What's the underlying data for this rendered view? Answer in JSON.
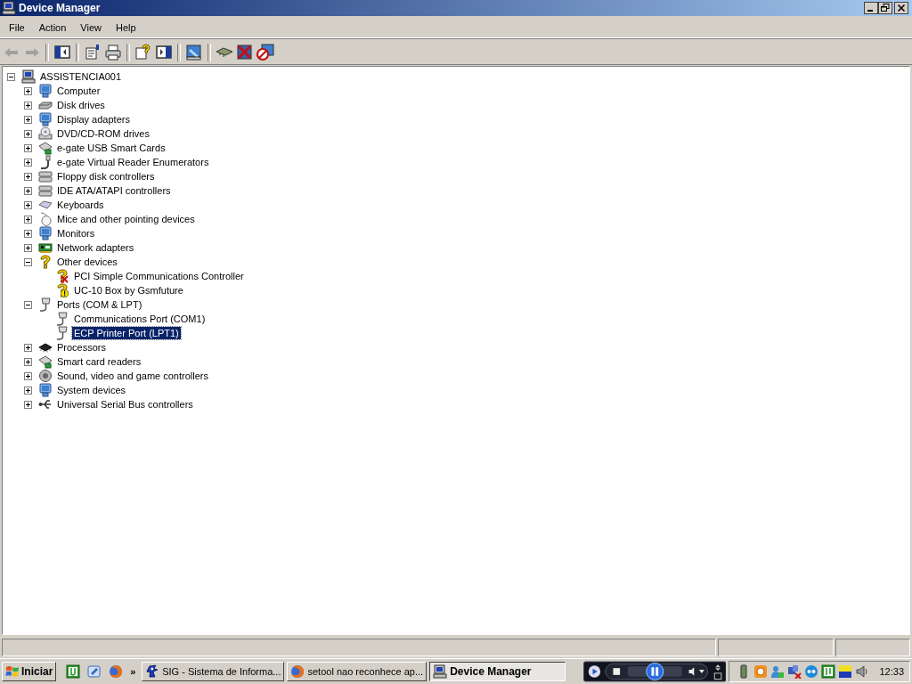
{
  "window": {
    "title": "Device Manager"
  },
  "menu": [
    "File",
    "Action",
    "View",
    "Help"
  ],
  "toolbar": [
    {
      "kind": "back",
      "disabled": true
    },
    {
      "kind": "forward",
      "disabled": true
    },
    {
      "kind": "separator"
    },
    {
      "kind": "treepane",
      "disabled": false
    },
    {
      "kind": "separator"
    },
    {
      "kind": "properties",
      "disabled": false
    },
    {
      "kind": "print",
      "disabled": false
    },
    {
      "kind": "separator"
    },
    {
      "kind": "help",
      "disabled": false
    },
    {
      "kind": "pane",
      "disabled": false
    },
    {
      "kind": "separator"
    },
    {
      "kind": "scan",
      "disabled": false
    },
    {
      "kind": "separator"
    },
    {
      "kind": "update",
      "disabled": false
    },
    {
      "kind": "uninstall",
      "disabled": false
    },
    {
      "kind": "disable",
      "disabled": false
    }
  ],
  "tree": {
    "label": "ASSISTENCIA001",
    "kind": "computer",
    "expanded": true,
    "selected": false,
    "children": [
      {
        "label": "Computer",
        "kind": "display",
        "expanded": false,
        "selected": false
      },
      {
        "label": "Disk drives",
        "kind": "disk",
        "expanded": false,
        "selected": false
      },
      {
        "label": "Display adapters",
        "kind": "display",
        "expanded": false,
        "selected": false
      },
      {
        "label": "DVD/CD-ROM drives",
        "kind": "optical",
        "expanded": false,
        "selected": false
      },
      {
        "label": "e-gate USB Smart Cards",
        "kind": "cardreader",
        "expanded": false,
        "selected": false
      },
      {
        "label": "e-gate Virtual Reader Enumerators",
        "kind": "connector",
        "expanded": false,
        "selected": false
      },
      {
        "label": "Floppy disk controllers",
        "kind": "controller",
        "expanded": false,
        "selected": false
      },
      {
        "label": "IDE ATA/ATAPI controllers",
        "kind": "controller",
        "expanded": false,
        "selected": false
      },
      {
        "label": "Keyboards",
        "kind": "keyboard",
        "expanded": false,
        "selected": false
      },
      {
        "label": "Mice and other pointing devices",
        "kind": "mouse",
        "expanded": false,
        "selected": false
      },
      {
        "label": "Monitors",
        "kind": "display",
        "expanded": false,
        "selected": false
      },
      {
        "label": "Network adapters",
        "kind": "network",
        "expanded": false,
        "selected": false
      },
      {
        "label": "Other devices",
        "kind": "unknown",
        "expanded": true,
        "selected": false,
        "children": [
          {
            "label": "PCI Simple Communications Controller",
            "kind": "unknown",
            "disabled": true,
            "warning": false,
            "selected": false
          },
          {
            "label": "UC-10 Box by Gsmfuture",
            "kind": "unknown",
            "disabled": false,
            "warning": true,
            "selected": false
          }
        ]
      },
      {
        "label": "Ports (COM & LPT)",
        "kind": "port",
        "expanded": true,
        "selected": false,
        "children": [
          {
            "label": "Communications Port (COM1)",
            "kind": "port",
            "selected": false
          },
          {
            "label": "ECP Printer Port (LPT1)",
            "kind": "port",
            "selected": true
          }
        ]
      },
      {
        "label": "Processors",
        "kind": "processor",
        "expanded": false,
        "selected": false
      },
      {
        "label": "Smart card readers",
        "kind": "cardreader",
        "expanded": false,
        "selected": false
      },
      {
        "label": "Sound, video and game controllers",
        "kind": "sound",
        "expanded": false,
        "selected": false
      },
      {
        "label": "System devices",
        "kind": "display",
        "expanded": false,
        "selected": false
      },
      {
        "label": "Universal Serial Bus controllers",
        "kind": "usb",
        "expanded": false,
        "selected": false
      }
    ]
  },
  "taskbar": {
    "start": "Iniciar",
    "chevron": "»",
    "tasks": [
      {
        "label": "SIG - Sistema de Informa...",
        "kind": "app",
        "selected": false
      },
      {
        "label": "setool nao reconhece ap...",
        "kind": "browser",
        "selected": false
      },
      {
        "label": "Device Manager",
        "kind": "computer",
        "selected": true
      }
    ],
    "clock": "12:33"
  }
}
